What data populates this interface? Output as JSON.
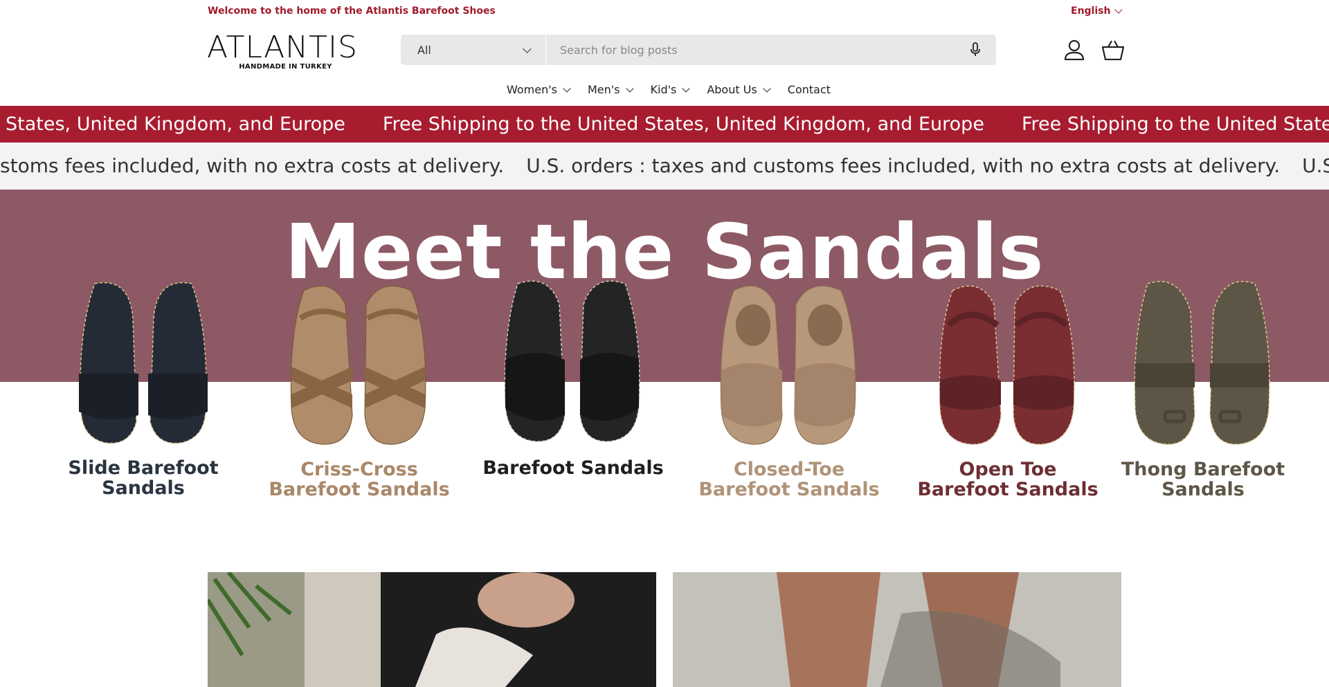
{
  "announcement": {
    "welcome": "Welcome to the home of the Atlantis Barefoot Shoes",
    "language": "English"
  },
  "logo": {
    "word": "ATLANTIS",
    "tagline": "HANDMADE IN TURKEY"
  },
  "search": {
    "category": "All",
    "placeholder": "Search for blog posts"
  },
  "nav": [
    {
      "label": "Women's",
      "has_menu": true
    },
    {
      "label": "Men's",
      "has_menu": true
    },
    {
      "label": "Kid's",
      "has_menu": true
    },
    {
      "label": "About Us",
      "has_menu": true
    },
    {
      "label": "Contact",
      "has_menu": false
    }
  ],
  "marquee": {
    "shipping_head": "States, United Kingdom, and Europe",
    "shipping_full": "Free Shipping to the United States, United Kingdom, and Europe",
    "shipping_tail": "Free Shipping to the United States, Unit",
    "customs_head": "stoms fees included, with no extra costs at delivery.",
    "customs_full": "U.S. orders : taxes and customs fees included, with no extra costs at delivery.",
    "customs_tail": "U.S. orders : taxe"
  },
  "hero": {
    "title": "Meet the Sandals"
  },
  "products": [
    {
      "name": "Slide Barefoot Sandals",
      "color": "#2b3441"
    },
    {
      "name": "Criss-Cross Barefoot Sandals",
      "color": "#a98868"
    },
    {
      "name": "Barefoot Sandals",
      "color": "#1f1f1f"
    },
    {
      "name": "Closed-Toe Barefoot Sandals",
      "color": "#b09378"
    },
    {
      "name": "Open Toe Barefoot Sandals",
      "color": "#6d2f33"
    },
    {
      "name": "Thong Barefoot Sandals",
      "color": "#5e5647"
    }
  ],
  "colors": {
    "brand_red": "#a81c2f",
    "hero_bg": "#8d5964"
  }
}
